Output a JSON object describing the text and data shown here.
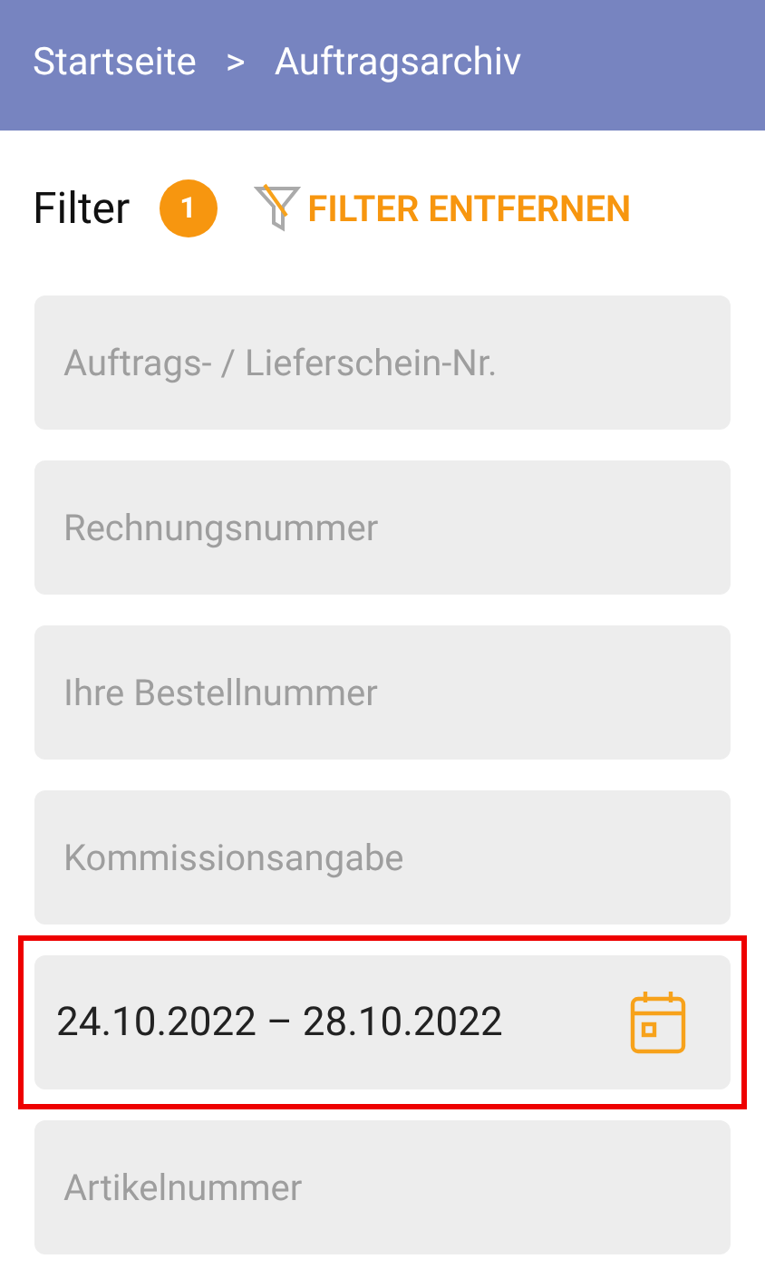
{
  "breadcrumb": [
    {
      "label": "Startseite"
    },
    {
      "label": "Auftragsarchiv"
    }
  ],
  "breadcrumb_separator": ">",
  "filter": {
    "title": "Filter",
    "count": "1",
    "clear_label": "FILTER ENTFERNEN"
  },
  "fields": [
    {
      "kind": "text",
      "placeholder": "Auftrags- / Lieferschein-Nr.",
      "highlighted": false
    },
    {
      "kind": "text",
      "placeholder": "Rechnungsnummer",
      "highlighted": false
    },
    {
      "kind": "text",
      "placeholder": "Ihre Bestellnummer",
      "highlighted": false
    },
    {
      "kind": "text",
      "placeholder": "Kommissionsangabe",
      "highlighted": false
    },
    {
      "kind": "date",
      "value": "24.10.2022 – 28.10.2022",
      "highlighted": true
    },
    {
      "kind": "text",
      "placeholder": "Artikelnummer",
      "highlighted": false
    }
  ]
}
